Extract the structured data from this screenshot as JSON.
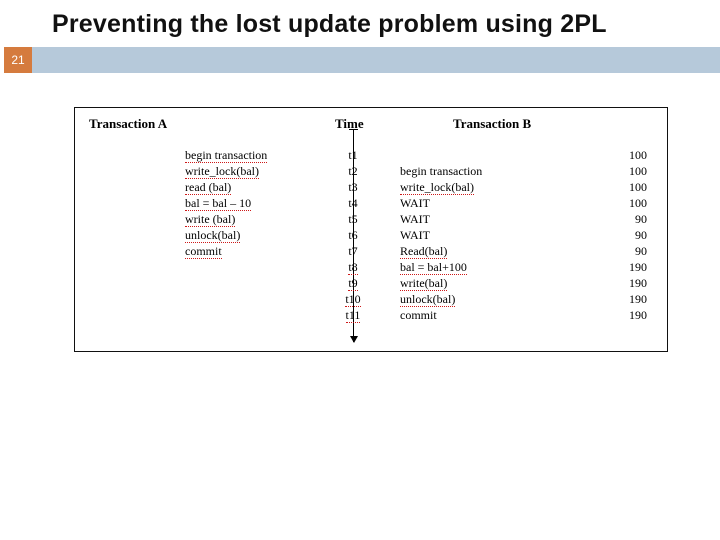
{
  "slide": {
    "title": "Preventing the lost update problem using 2PL",
    "page_number": "21"
  },
  "figure": {
    "headers": {
      "a": "Transaction A",
      "time": "Time",
      "b": "Transaction B"
    },
    "rows": [
      {
        "a": "begin transaction",
        "t": "t1",
        "b": "",
        "c": "100",
        "aMark": true,
        "bMark": false,
        "tMark": false
      },
      {
        "a": "write_lock(bal)",
        "t": "t2",
        "b": "begin transaction",
        "c": "100",
        "aMark": true,
        "bMark": false,
        "tMark": false
      },
      {
        "a": "read (bal)",
        "t": "t3",
        "b": "write_lock(bal)",
        "c": "100",
        "aMark": true,
        "bMark": true,
        "tMark": false
      },
      {
        "a": "bal = bal – 10",
        "t": "t4",
        "b": "WAIT",
        "c": "100",
        "aMark": true,
        "bMark": false,
        "tMark": false
      },
      {
        "a": "write (bal)",
        "t": "t5",
        "b": "WAIT",
        "c": "90",
        "aMark": true,
        "bMark": false,
        "tMark": false
      },
      {
        "a": "unlock(bal)",
        "t": "t6",
        "b": "WAIT",
        "c": "90",
        "aMark": true,
        "bMark": false,
        "tMark": false
      },
      {
        "a": "commit",
        "t": "t7",
        "b": "Read(bal)",
        "c": "90",
        "aMark": true,
        "bMark": true,
        "tMark": false
      },
      {
        "a": "",
        "t": "t8",
        "b": "bal = bal+100",
        "c": "190",
        "aMark": false,
        "bMark": true,
        "tMark": true
      },
      {
        "a": "",
        "t": "t9",
        "b": "write(bal)",
        "c": "190",
        "aMark": false,
        "bMark": true,
        "tMark": true
      },
      {
        "a": "",
        "t": "t10",
        "b": "unlock(bal)",
        "c": "190",
        "aMark": false,
        "bMark": true,
        "tMark": true
      },
      {
        "a": "",
        "t": "t11",
        "b": "commit",
        "c": "190",
        "aMark": false,
        "bMark": false,
        "tMark": true
      }
    ]
  }
}
